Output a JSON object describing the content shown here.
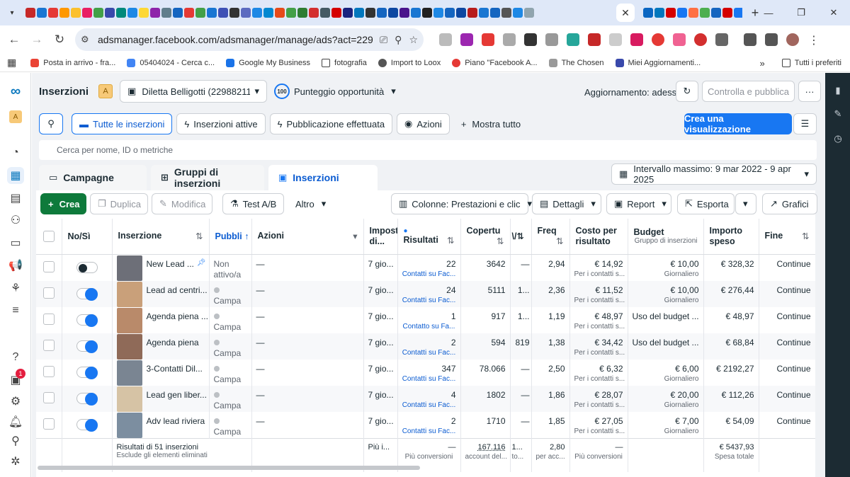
{
  "browser": {
    "url": "adsmanager.facebook.com/adsmanager/manage/ads?act=229882...",
    "bookmarks": [
      "Posta in arrivo - fra...",
      "05404024 - Cerca c...",
      "Google My Business",
      "fotografia",
      "Import to Loox",
      "Piano \"Facebook A...",
      "The Chosen",
      "Miei Aggiornamenti..."
    ],
    "bookmarks_more": "Tutti i preferiti"
  },
  "header": {
    "page_title": "Inserzioni",
    "account_badge": "A",
    "account_name": "Diletta Belligotti (22988211...",
    "score_value": "100",
    "score_label": "Punteggio opportunità",
    "update_status": "Aggiornamento: adesso",
    "review_button": "Controlla e pubblica",
    "more_button": "···"
  },
  "filters": {
    "items": [
      "Tutte le inserzioni",
      "Inserzioni attive",
      "Pubblicazione effettuata",
      "Azioni"
    ],
    "show_all": "Mostra tutto",
    "create_view": "Crea una visualizzazione"
  },
  "search": {
    "placeholder": "Cerca per nome, ID o metriche"
  },
  "level_tabs": [
    "Campagne",
    "Gruppi di inserzioni",
    "Inserzioni"
  ],
  "date_range": "Intervallo massimo: 9 mar 2022 - 9 apr 2025",
  "toolbar": {
    "create": "Crea",
    "duplicate": "Duplica",
    "edit": "Modifica",
    "ab_test": "Test A/B",
    "more": "Altro",
    "columns": "Colonne: Prestazioni e clic",
    "details": "Dettagli",
    "report": "Report",
    "export": "Esporta",
    "charts": "Grafici"
  },
  "columns": {
    "onoff": "No/Sì",
    "ad": "Inserzione",
    "pub": "Pubbli",
    "actions": "Azioni",
    "impost": "Impost di...",
    "results": "Risultati",
    "reach": "Copertu",
    "impr": "\\/",
    "freq": "Freq",
    "cpr": "Costo per risultato",
    "budget": "Budget",
    "budget_sub": "Gruppo di inserzioni",
    "spend": "Importo speso",
    "end": "Fine"
  },
  "rows": [
    {
      "on": false,
      "name": "New Lead ...",
      "pub": "Non attivo/a",
      "actions": "—",
      "impost": "7 gio...",
      "results": "22",
      "results_sub": "Contatti su Fac...",
      "reach": "3642",
      "impr": "—",
      "freq": "2,94",
      "cpr": "€ 14,92",
      "cpr_sub": "Per i contatti s...",
      "budget": "€ 10,00",
      "budget_sub": "Giornaliero",
      "spend": "€ 328,32",
      "end": "Continue"
    },
    {
      "on": true,
      "name": "Lead ad centri...",
      "pub": "Campa",
      "actions": "—",
      "impost": "7 gio...",
      "results": "24",
      "results_sub": "Contatti su Fac...",
      "reach": "5111",
      "impr": "1...",
      "freq": "2,36",
      "cpr": "€ 11,52",
      "cpr_sub": "Per i contatti s...",
      "budget": "€ 10,00",
      "budget_sub": "Giornaliero",
      "spend": "€ 276,44",
      "end": "Continue"
    },
    {
      "on": true,
      "name": "Agenda piena ...",
      "pub": "Campa",
      "actions": "—",
      "impost": "7 gio...",
      "results": "1",
      "results_sub": "Contatto su Fa...",
      "reach": "917",
      "impr": "1...",
      "freq": "1,19",
      "cpr": "€ 48,97",
      "cpr_sub": "Per i contatti s...",
      "budget": "Uso del budget ...",
      "budget_sub": "",
      "spend": "€ 48,97",
      "end": "Continue"
    },
    {
      "on": true,
      "name": "Agenda piena",
      "pub": "Campa",
      "actions": "—",
      "impost": "7 gio...",
      "results": "2",
      "results_sub": "Contatti su Fac...",
      "reach": "594",
      "impr": "819",
      "freq": "1,38",
      "cpr": "€ 34,42",
      "cpr_sub": "Per i contatti s...",
      "budget": "Uso del budget ...",
      "budget_sub": "",
      "spend": "€ 68,84",
      "end": "Continue"
    },
    {
      "on": true,
      "name": "3-Contatti Dil...",
      "pub": "Campa",
      "actions": "—",
      "impost": "7 gio...",
      "results": "347",
      "results_sub": "Contatti su Fac...",
      "reach": "78.066",
      "impr": "—",
      "freq": "2,50",
      "cpr": "€ 6,32",
      "cpr_sub": "Per i contatti s...",
      "budget": "€ 6,00",
      "budget_sub": "Giornaliero",
      "spend": "€ 2192,27",
      "end": "Continue"
    },
    {
      "on": true,
      "name": "Lead gen liber...",
      "pub": "Campa",
      "actions": "—",
      "impost": "7 gio...",
      "results": "4",
      "results_sub": "Contatti su Fac...",
      "reach": "1802",
      "impr": "—",
      "freq": "1,86",
      "cpr": "€ 28,07",
      "cpr_sub": "Per i contatti s...",
      "budget": "€ 20,00",
      "budget_sub": "Giornaliero",
      "spend": "€ 112,26",
      "end": "Continue"
    },
    {
      "on": true,
      "name": "Adv lead riviera",
      "pub": "Campa",
      "actions": "—",
      "impost": "7 gio...",
      "results": "2",
      "results_sub": "Contatti su Fac...",
      "reach": "1710",
      "impr": "—",
      "freq": "1,85",
      "cpr": "€ 27,05",
      "cpr_sub": "Per i contatti s...",
      "budget": "€ 7,00",
      "budget_sub": "Giornaliero",
      "spend": "€ 54,09",
      "end": "Continue"
    }
  ],
  "summary": {
    "label": "Risultati di 51 inserzioni",
    "sub": "Esclude gli elementi eliminati",
    "impost": "Più i...",
    "results": "—",
    "results_sub": "Più conversioni",
    "reach": "167.116",
    "reach_sub": "account del...",
    "impr": "1...",
    "impr_sub": "to...",
    "freq": "2,80",
    "freq_sub": "per acc...",
    "cpr": "—",
    "cpr_sub": "Più conversioni",
    "spend": "€ 5437,93",
    "spend_sub": "Spesa totale"
  }
}
